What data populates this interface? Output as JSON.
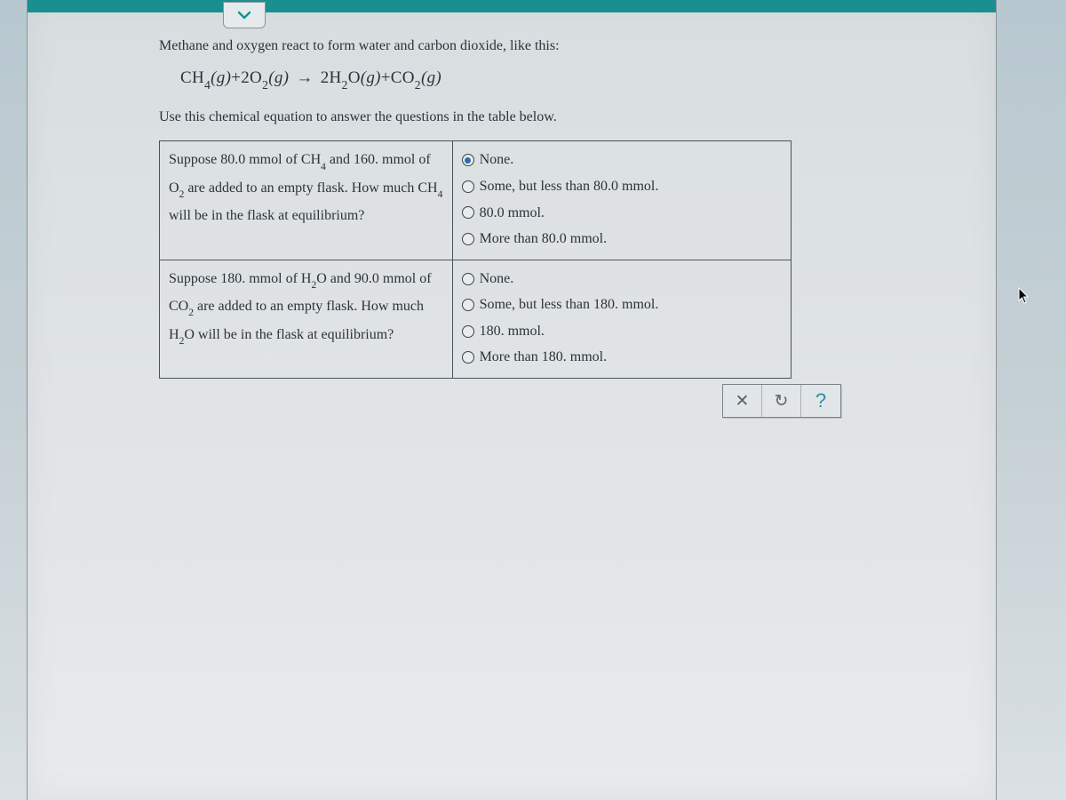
{
  "intro": "Methane and oxygen react to form water and carbon dioxide, like this:",
  "equation": {
    "lhs_a_base": "CH",
    "lhs_a_sub": "4",
    "lhs_a_state": "(g)",
    "plus1": "+",
    "lhs_b_coef": "2",
    "lhs_b_base": "O",
    "lhs_b_sub": "2",
    "lhs_b_state": "(g)",
    "arrow": "→",
    "rhs_a_coef": "2",
    "rhs_a_base": "H",
    "rhs_a_sub": "2",
    "rhs_a_base2": "O",
    "rhs_a_state": "(g)",
    "plus2": "+",
    "rhs_b_base": "CO",
    "rhs_b_sub": "2",
    "rhs_b_state": "(g)"
  },
  "instruction": "Use this chemical equation to answer the questions in the table below.",
  "questions": [
    {
      "prompt_parts": {
        "p1": "Suppose 80.0 mmol of CH",
        "p1sub": "4",
        "p2": " and 160. mmol of O",
        "p2sub": "2",
        "p3": " are added to an empty flask. How much CH",
        "p3sub": "4",
        "p4": " will be in the flask at equilibrium?"
      },
      "options": [
        {
          "label": "None.",
          "selected": true
        },
        {
          "label": "Some, but less than 80.0 mmol.",
          "selected": false
        },
        {
          "label": "80.0 mmol.",
          "selected": false
        },
        {
          "label": "More than 80.0 mmol.",
          "selected": false
        }
      ]
    },
    {
      "prompt_parts": {
        "p1": "Suppose 180. mmol of H",
        "p1sub": "2",
        "p1b": "O",
        "p2": " and 90.0 mmol of CO",
        "p2sub": "2",
        "p3": " are added to an empty flask. How much H",
        "p3sub": "2",
        "p3b": "O",
        "p4": " will be in the flask at equilibrium?"
      },
      "options": [
        {
          "label": "None.",
          "selected": false
        },
        {
          "label": "Some, but less than 180. mmol.",
          "selected": false
        },
        {
          "label": "180. mmol.",
          "selected": false
        },
        {
          "label": "More than 180. mmol.",
          "selected": false
        }
      ]
    }
  ],
  "actions": {
    "clear": "✕",
    "reset": "↻",
    "help": "?"
  }
}
